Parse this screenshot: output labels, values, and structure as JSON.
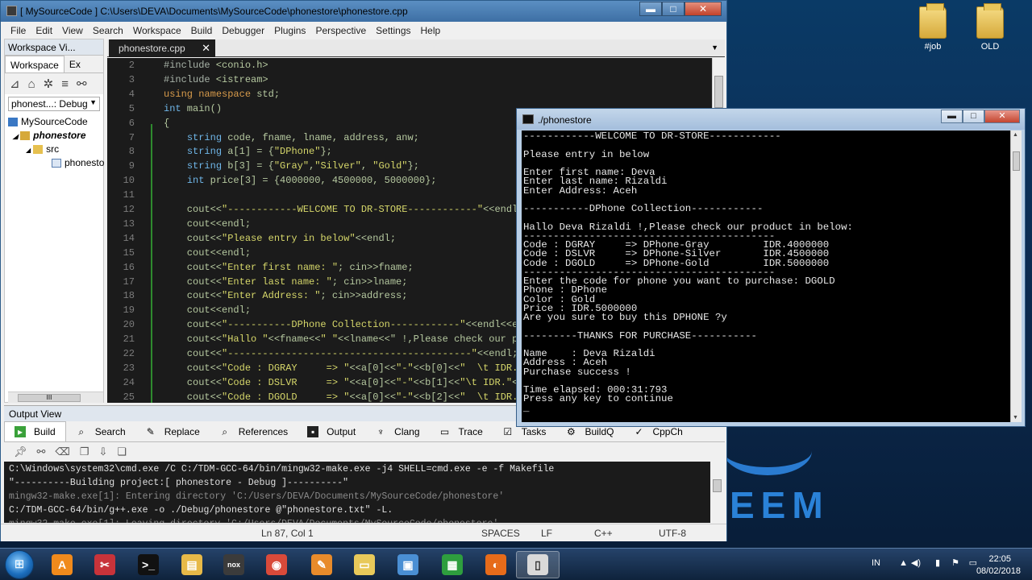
{
  "desktop": {
    "icons": [
      {
        "label": "#job"
      },
      {
        "label": "OLD"
      }
    ],
    "wallpaper_text": "EEM"
  },
  "ide": {
    "title": "[ MySourceCode ] C:\\Users\\DEVA\\Documents\\MySourceCode\\phonestore\\phonestore.cpp",
    "window_buttons": {
      "minimize": "▬",
      "maximize": "□",
      "close": "✕"
    },
    "menu": [
      "File",
      "Edit",
      "View",
      "Search",
      "Workspace",
      "Build",
      "Debugger",
      "Plugins",
      "Perspective",
      "Settings",
      "Help"
    ],
    "workspace_view": {
      "title": "Workspace Vi...",
      "tabs": [
        "Workspace",
        "Ex"
      ],
      "config": "phonest...: Debug",
      "tree": [
        {
          "label": "MySourceCode",
          "bold": false
        },
        {
          "label": "phonestore",
          "bold": true
        },
        {
          "label": "src",
          "bold": false
        },
        {
          "label": "phonesto",
          "bold": false
        }
      ],
      "scroll_label": "III"
    },
    "editor": {
      "tab": "phonestore.cpp",
      "lines": [
        {
          "n": "2",
          "t": "#include <conio.h>"
        },
        {
          "n": "3",
          "t": "#include <istream>"
        },
        {
          "n": "4",
          "t": "using namespace std;"
        },
        {
          "n": "5",
          "t": "int main()"
        },
        {
          "n": "6",
          "t": "{"
        },
        {
          "n": "7",
          "t": "    string code, fname, lname, address, anw;"
        },
        {
          "n": "8",
          "t": "    string a[1] = {\"DPhone\"};"
        },
        {
          "n": "9",
          "t": "    string b[3] = {\"Gray\",\"Silver\", \"Gold\"};"
        },
        {
          "n": "10",
          "t": "    int price[3] = {4000000, 4500000, 5000000};"
        },
        {
          "n": "11",
          "t": ""
        },
        {
          "n": "12",
          "t": "    cout<<\"------------WELCOME TO DR-STORE------------\"<<endl;"
        },
        {
          "n": "13",
          "t": "    cout<<endl;"
        },
        {
          "n": "14",
          "t": "    cout<<\"Please entry in below\"<<endl;"
        },
        {
          "n": "15",
          "t": "    cout<<endl;"
        },
        {
          "n": "16",
          "t": "    cout<<\"Enter first name: \"; cin>>fname;"
        },
        {
          "n": "17",
          "t": "    cout<<\"Enter last name: \"; cin>>lname;"
        },
        {
          "n": "18",
          "t": "    cout<<\"Enter Address: \"; cin>>address;"
        },
        {
          "n": "19",
          "t": "    cout<<endl;"
        },
        {
          "n": "20",
          "t": "    cout<<\"-----------DPhone Collection------------\"<<endl<<er"
        },
        {
          "n": "21",
          "t": "    cout<<\"Hallo \"<<fname<<\" \"<<lname<<\" !,Please check our proc"
        },
        {
          "n": "22",
          "t": "    cout<<\"------------------------------------------\"<<endl;"
        },
        {
          "n": "23",
          "t": "    cout<<\"Code : DGRAY     => \"<<a[0]<<\"-\"<<b[0]<<\"  \\t IDR.\"<<"
        },
        {
          "n": "24",
          "t": "    cout<<\"Code : DSLVR     => \"<<a[0]<<\"-\"<<b[1]<<\"\\t IDR.\"<<pr"
        },
        {
          "n": "25",
          "t": "    cout<<\"Code : DGOLD     => \"<<a[0]<<\"-\"<<b[2]<<\"  \\t IDR.\"<<"
        }
      ]
    },
    "output": {
      "title": "Output View",
      "tabs": [
        "Build",
        "Search",
        "Replace",
        "References",
        "Output",
        "Clang",
        "Trace",
        "Tasks",
        "BuildQ",
        "CppCh"
      ],
      "log": [
        {
          "t": "C:\\Windows\\system32\\cmd.exe /C C:/TDM-GCC-64/bin/mingw32-make.exe -j4 SHELL=cmd.exe -e -f  Makefile",
          "dim": false
        },
        {
          "t": "\"----------Building project:[ phonestore - Debug ]----------\"",
          "dim": false
        },
        {
          "t": "mingw32-make.exe[1]: Entering directory 'C:/Users/DEVA/Documents/MySourceCode/phonestore'",
          "dim": true
        },
        {
          "t": "C:/TDM-GCC-64/bin/g++.exe -o ./Debug/phonestore @\"phonestore.txt\" -L.",
          "dim": false
        },
        {
          "t": "mingw32-make.exe[1]: Leaving directory 'C:/Users/DEVA/Documents/MySourceCode/phonestore'",
          "dim": true
        }
      ]
    },
    "status": {
      "pos": "Ln 87, Col 1",
      "indent": "SPACES",
      "eol": "LF",
      "lang": "C++",
      "enc": "UTF-8"
    }
  },
  "console": {
    "title": "./phonestore",
    "buttons": {
      "minimize": "▬",
      "maximize": "□",
      "close": "✕"
    },
    "text": "------------WELCOME TO DR-STORE------------\n\nPlease entry in below\n\nEnter first name: Deva\nEnter last name: Rizaldi\nEnter Address: Aceh\n\n-----------DPhone Collection------------\n\nHallo Deva Rizaldi !,Please check our product in below:\n------------------------------------------\nCode : DGRAY     => DPhone-Gray         IDR.4000000\nCode : DSLVR     => DPhone-Silver       IDR.4500000\nCode : DGOLD     => DPhone-Gold         IDR.5000000\n------------------------------------------\nEnter the code for phone you want to purchase: DGOLD\nPhone : DPhone\nColor : Gold\nPrice : IDR.5000000\nAre you sure to buy this DPHONE ?y\n\n---------THANKS FOR PURCHASE-----------\n\nName    : Deva Rizaldi\nAddress : Aceh\nPurchase success !\n\nTime elapsed: 000:31:793\nPress any key to continue\n_"
  },
  "taskbar": {
    "start_label": "⊞",
    "apps": [
      {
        "name": "avast",
        "glyph": "A",
        "color": "#f08a1c"
      },
      {
        "name": "snipping",
        "glyph": "✂",
        "color": "#c8333a"
      },
      {
        "name": "cmd",
        "glyph": ">_",
        "color": "#111111"
      },
      {
        "name": "explorer",
        "glyph": "▤",
        "color": "#e7b948"
      },
      {
        "name": "nox",
        "glyph": "nox",
        "color": "#3b3b3b"
      },
      {
        "name": "chrome",
        "glyph": "◉",
        "color": "#d94a3a"
      },
      {
        "name": "paint",
        "glyph": "✎",
        "color": "#e88b2b"
      },
      {
        "name": "folder",
        "glyph": "▭",
        "color": "#e8c95a"
      },
      {
        "name": "screen",
        "glyph": "▣",
        "color": "#4a8fd4"
      },
      {
        "name": "office",
        "glyph": "▦",
        "color": "#2e9e3e"
      },
      {
        "name": "firefox",
        "glyph": "◐",
        "color": "#e66b1a"
      },
      {
        "name": "codelite",
        "glyph": "▯",
        "color": "#d9d9d9"
      }
    ],
    "tray": {
      "lang": "IN",
      "time": "22:05",
      "date": "08/02/2018"
    }
  }
}
